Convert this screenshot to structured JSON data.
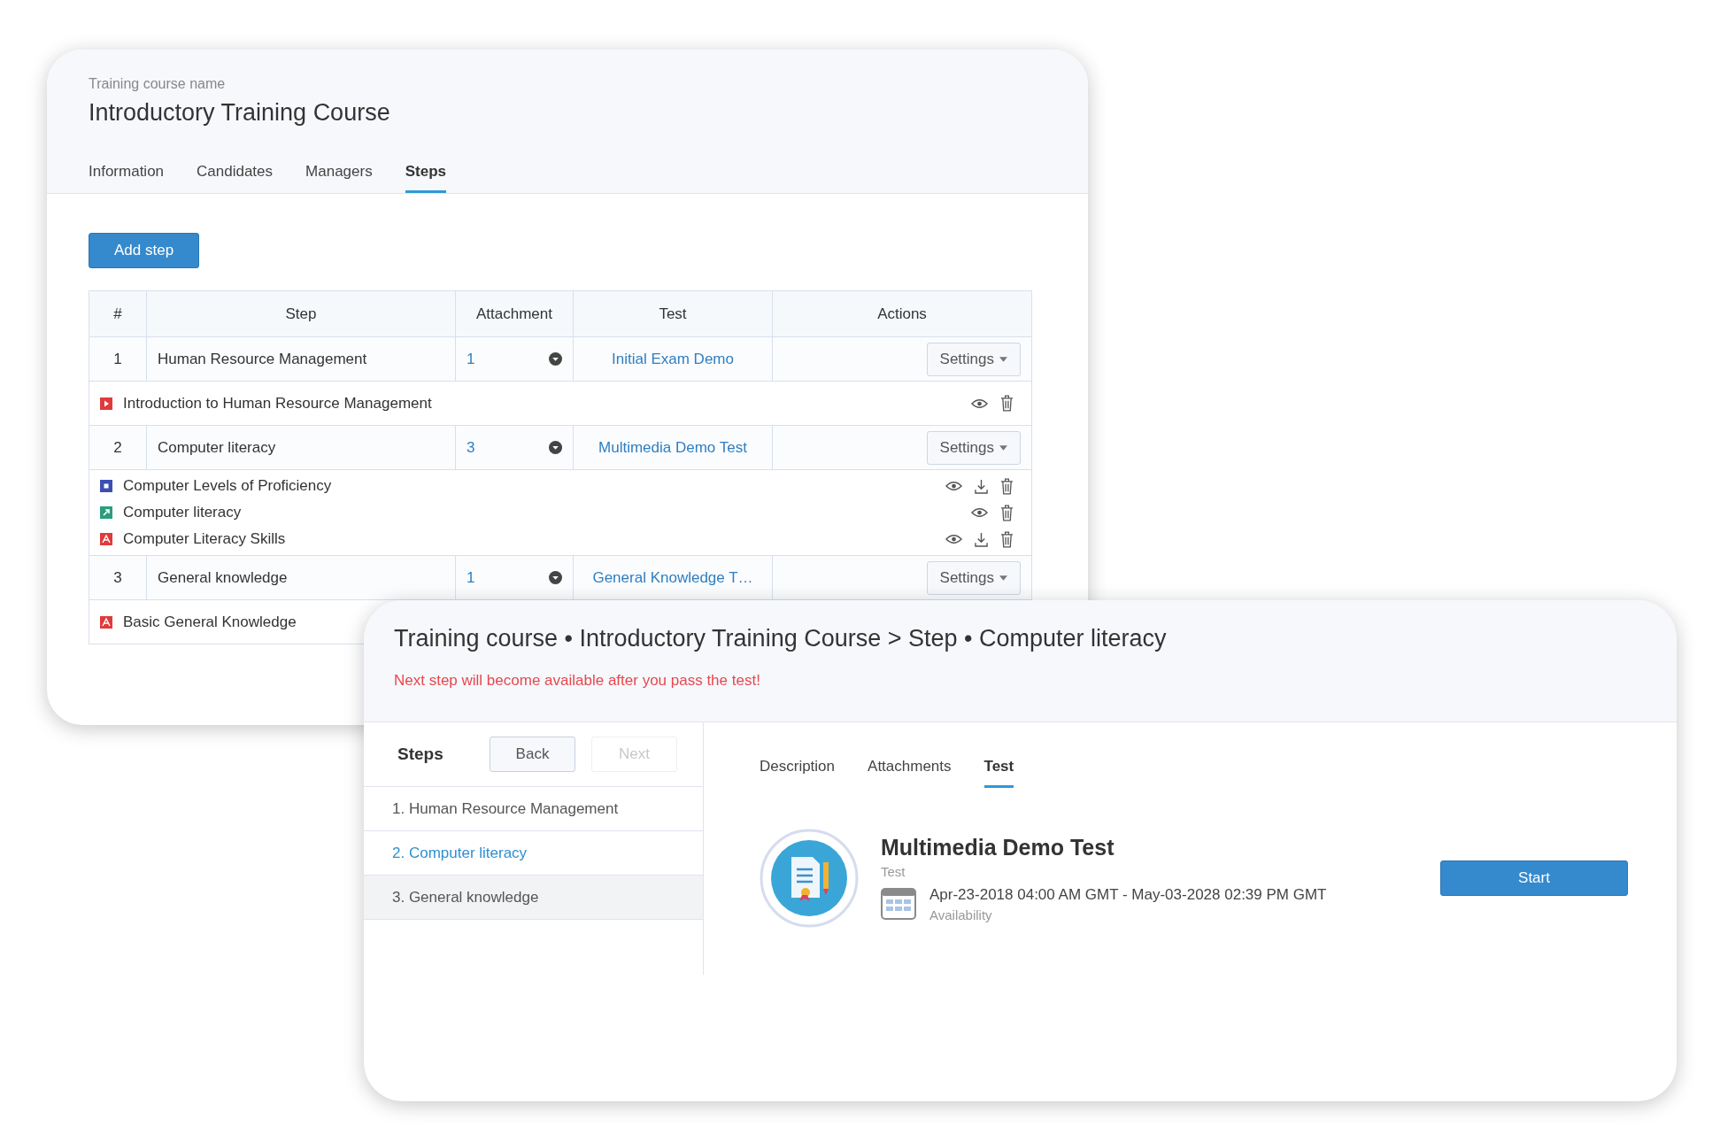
{
  "course": {
    "label": "Training course name",
    "title": "Introductory Training Course",
    "tabs": [
      {
        "label": "Information",
        "selected": false
      },
      {
        "label": "Candidates",
        "selected": false
      },
      {
        "label": "Managers",
        "selected": false
      },
      {
        "label": "Steps",
        "selected": true
      }
    ],
    "add_button": "Add step",
    "table": {
      "columns": [
        "#",
        "Step",
        "Attachment",
        "Test",
        "Actions"
      ],
      "steps": [
        {
          "number": "1",
          "name": "Human Resource Management",
          "attachment_count": "1",
          "test": "Initial Exam Demo",
          "settings": "Settings",
          "attachments": [
            {
              "name": "Introduction to Human Resource Management",
              "kind": "video",
              "downloadable": false
            }
          ]
        },
        {
          "number": "2",
          "name": "Computer literacy",
          "attachment_count": "3",
          "test": "Multimedia Demo Test",
          "settings": "Settings",
          "attachments": [
            {
              "name": "Computer Levels of Proficiency",
              "kind": "document",
              "downloadable": true
            },
            {
              "name": "Computer literacy",
              "kind": "link",
              "downloadable": false
            },
            {
              "name": "Computer Literacy Skills",
              "kind": "pdf",
              "downloadable": true
            }
          ]
        },
        {
          "number": "3",
          "name": "General knowledge",
          "attachment_count": "1",
          "test": "General Knowledge T…",
          "settings": "Settings",
          "attachments": [
            {
              "name": "Basic General Knowledge",
              "kind": "pdf",
              "show_actions": false
            }
          ]
        }
      ]
    }
  },
  "viewer": {
    "title": "Training course • Introductory Training Course > Step • Computer literacy",
    "notice": "Next step will become available after you pass the test!",
    "steps_label": "Steps",
    "back": {
      "label": "Back",
      "disabled": false
    },
    "next": {
      "label": "Next",
      "disabled": true
    },
    "steps": [
      {
        "label": "1. Human Resource Management",
        "selected": false,
        "highlighted": false
      },
      {
        "label": "2. Computer literacy",
        "selected": true,
        "highlighted": false
      },
      {
        "label": "3. General knowledge",
        "selected": false,
        "highlighted": true
      }
    ],
    "tabs": [
      {
        "label": "Description",
        "selected": false
      },
      {
        "label": "Attachments",
        "selected": false
      },
      {
        "label": "Test",
        "selected": true
      }
    ],
    "test": {
      "title": "Multimedia Demo Test",
      "type": "Test",
      "dates": "Apr-23-2018 04:00 AM GMT - May-03-2028 02:39 PM GMT",
      "dates_label": "Availability",
      "start": "Start"
    }
  }
}
